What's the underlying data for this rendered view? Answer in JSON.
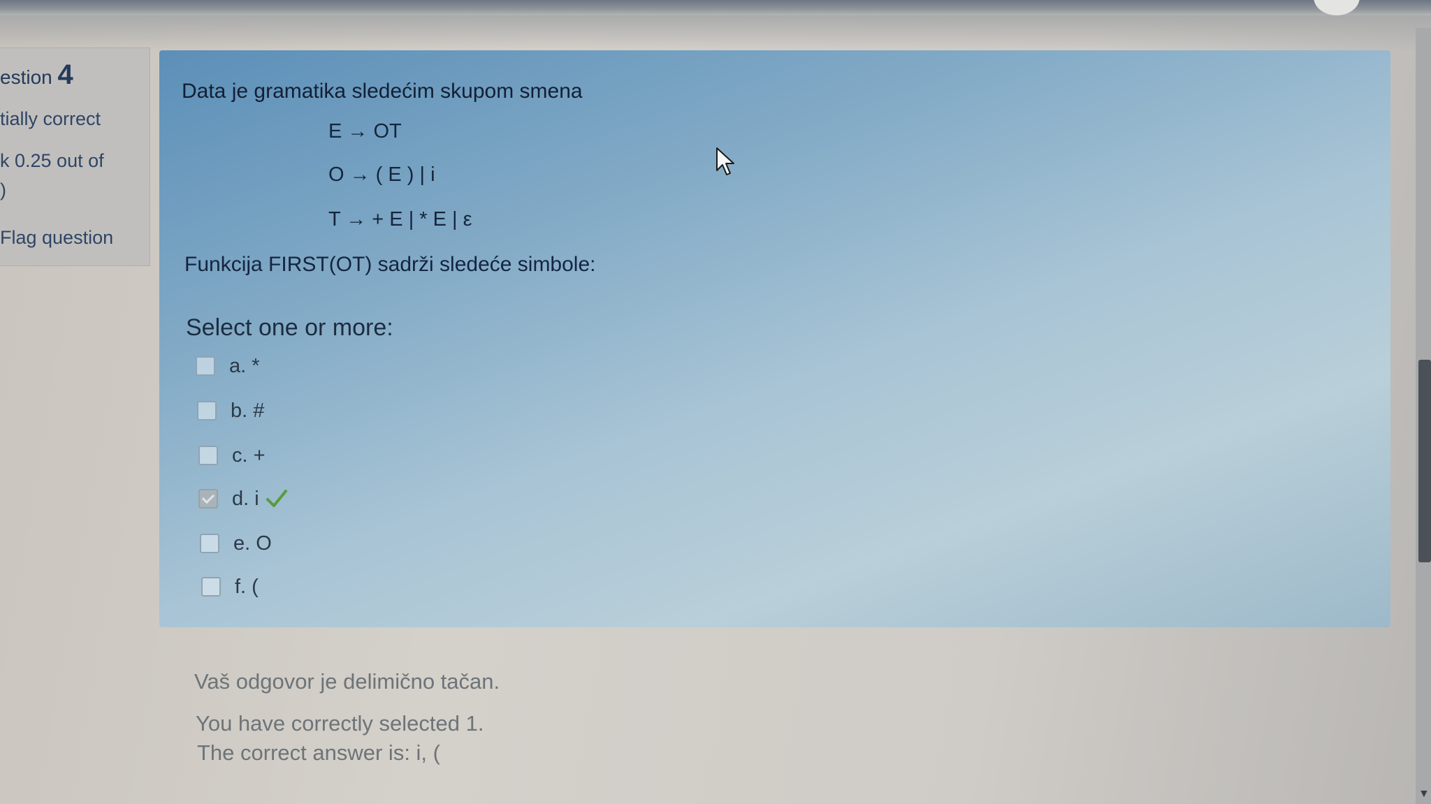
{
  "sidebar": {
    "question_prefix": "estion",
    "question_number": "4",
    "state": "tially correct",
    "mark_line1": "k 0.25 out of",
    "mark_line2": ")",
    "flag_label": "Flag question"
  },
  "question": {
    "intro": "Data je gramatika sledećim skupom smena",
    "rules": [
      "E → OT",
      "O → ( E ) | i",
      "T → + E | * E | ε"
    ],
    "prompt": "Funkcija FIRST(OT) sadrži sledeće simbole:",
    "select_label": "Select one or more:",
    "options": [
      {
        "label": "a. *",
        "checked": false
      },
      {
        "label": "b. #",
        "checked": false
      },
      {
        "label": "c. +",
        "checked": false
      },
      {
        "label": "d. i",
        "checked": true,
        "correct": true
      },
      {
        "label": "e. O",
        "checked": false
      },
      {
        "label": "f. (",
        "checked": false
      }
    ]
  },
  "feedback": {
    "line1": "Vaš odgovor je delimično tačan.",
    "line2": "You have correctly selected 1.",
    "line3": "The correct answer is: i, ("
  },
  "colors": {
    "question_box": "#82aac6",
    "info_box": "#c1bfbd",
    "tick": "#5a9a3a"
  }
}
